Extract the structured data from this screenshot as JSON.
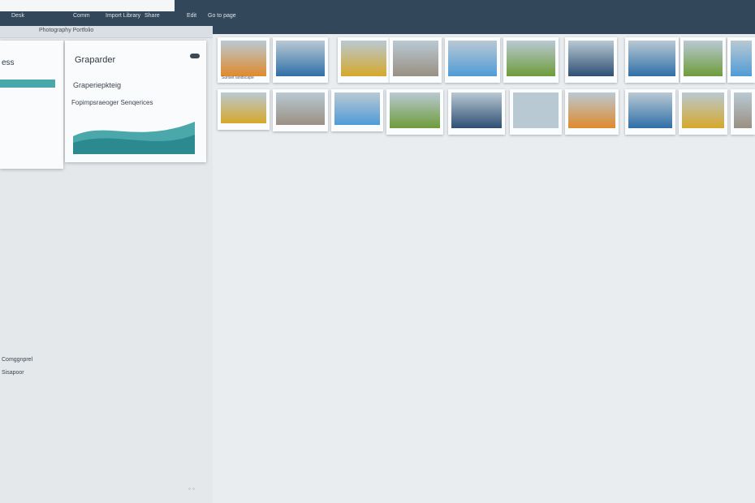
{
  "menu": [
    "Desk",
    "Comm",
    "Import Library",
    "Share",
    "Edit",
    "Go to page"
  ],
  "panel_label": "Photography Portfolio",
  "card_a": {
    "title": "ess"
  },
  "card_b": {
    "title": "Graparder",
    "subtitle": "Graperiepkteig",
    "line": "Fopimpsraeoger Senqerices"
  },
  "sidebar_texts": [
    "Comggnprel",
    "Sisapoor"
  ],
  "palette": {
    "sky": "#4f9bd6",
    "sea": "#2f6fa8",
    "sunset": "#e08a2c",
    "foliage": "#d6a82a",
    "grass": "#6e9c3a",
    "rock": "#9a9083",
    "dusk": "#2e4f74",
    "mist": "#b9c9d3"
  },
  "thumbs": [
    {
      "c": "Sunset landscape",
      "t": "sunset"
    },
    {
      "c": "",
      "t": "sea"
    },
    {
      "c": "",
      "t": "foliage"
    },
    {
      "c": "",
      "t": "rock"
    },
    {
      "c": "",
      "t": "sky"
    },
    {
      "c": "",
      "t": "grass"
    },
    {
      "c": "",
      "t": "dusk"
    },
    {
      "c": "",
      "t": "sea"
    },
    {
      "c": "",
      "t": "grass"
    },
    {
      "c": "",
      "t": "sky"
    }
  ]
}
